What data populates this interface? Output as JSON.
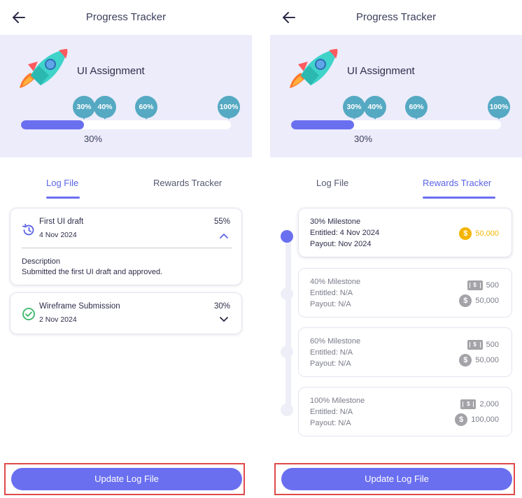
{
  "header": {
    "title": "Progress Tracker"
  },
  "assignment": {
    "title": "UI Assignment",
    "progress_percent": 30,
    "progress_label": "30%",
    "milestone_markers": [
      "30%",
      "40%",
      "60%",
      "100%"
    ]
  },
  "tabs": [
    {
      "label": "Log File"
    },
    {
      "label": "Rewards Tracker"
    }
  ],
  "log_entries": [
    {
      "title": "First UI draft",
      "date": "4 Nov 2024",
      "percent": "55%",
      "expanded": true,
      "description_heading": "Description",
      "description": "Submitted the first UI draft and approved."
    },
    {
      "title": "Wireframe Submission",
      "date": "2 Nov 2024",
      "percent": "30%",
      "expanded": false
    }
  ],
  "milestones": [
    {
      "title": "30% Milestone",
      "entitled": "Entitled: 4 Nov 2024",
      "payout": "Payout: Nov 2024",
      "achieved": true,
      "cash": null,
      "coins": "50,000"
    },
    {
      "title": "40% Milestone",
      "entitled": "Entitled: N/A",
      "payout": "Payout: N/A",
      "achieved": false,
      "cash": "500",
      "coins": "50,000"
    },
    {
      "title": "60% Milestone",
      "entitled": "Entitled: N/A",
      "payout": "Payout: N/A",
      "achieved": false,
      "cash": "500",
      "coins": "50,000"
    },
    {
      "title": "100% Milestone",
      "entitled": "Entitled: N/A",
      "payout": "Payout: N/A",
      "achieved": false,
      "cash": "2,000",
      "coins": "100,000"
    }
  ],
  "footer": {
    "button_label": "Update Log File"
  },
  "colors": {
    "accent": "#6a6ff0",
    "hero_bg": "#ececfb",
    "marker": "#55a9c2",
    "gold": "#f4b400",
    "highlight_border": "#e04a4a"
  },
  "icons": {
    "back": "arrow-left-icon",
    "rocket": "rocket-icon",
    "history": "history-icon",
    "check": "check-circle-icon",
    "chevron_up": "chevron-up-icon",
    "chevron_down": "chevron-down-icon",
    "coin": "coin-icon",
    "cash": "cash-icon"
  }
}
